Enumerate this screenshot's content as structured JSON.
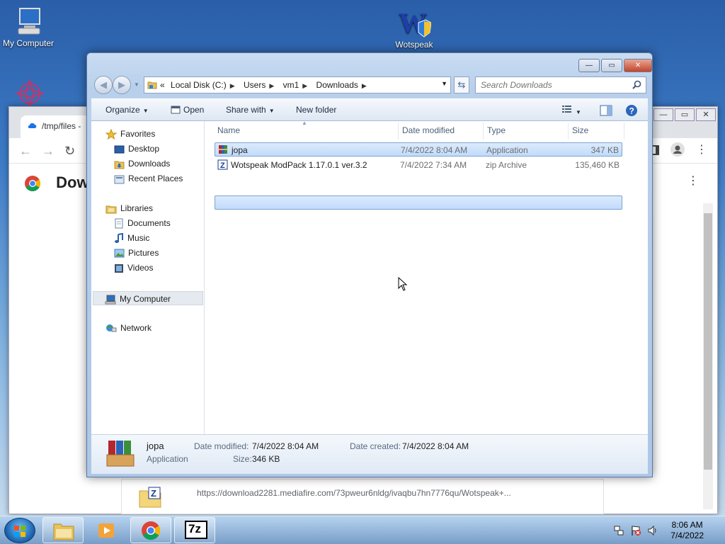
{
  "desktop": {
    "icons": [
      {
        "label": "My Computer",
        "icon": "computer-icon"
      },
      {
        "label": "Wotspeak",
        "icon": "wotspeak-icon"
      },
      {
        "label": "",
        "icon": "ornament-icon"
      }
    ]
  },
  "chrome": {
    "tab_title": "/tmp/files - ",
    "page_heading": "Dow",
    "download_url": "https://download2281.mediafire.com/73pweur6nldg/ivaqbu7hn7776qu/Wotspeak+..."
  },
  "explorer": {
    "title_controls": {
      "minimize": "—",
      "maximize": "▭",
      "close": "✕"
    },
    "breadcrumb": [
      "Local Disk (C:)",
      "Users",
      "vm1",
      "Downloads"
    ],
    "breadcrumb_prefix": "«",
    "search_placeholder": "Search Downloads",
    "toolbar": {
      "organize": "Organize",
      "open": "Open",
      "share_with": "Share with",
      "new_folder": "New folder"
    },
    "nav": {
      "favorites": "Favorites",
      "desktop": "Desktop",
      "downloads": "Downloads",
      "recent_places": "Recent Places",
      "libraries": "Libraries",
      "documents": "Documents",
      "music": "Music",
      "pictures": "Pictures",
      "videos": "Videos",
      "my_computer": "My Computer",
      "network": "Network"
    },
    "columns": {
      "name": "Name",
      "date_modified": "Date modified",
      "type": "Type",
      "size": "Size"
    },
    "files": [
      {
        "name": "jopa",
        "date": "7/4/2022 8:04 AM",
        "type": "Application",
        "size": "347 KB",
        "icon": "winrar-icon"
      },
      {
        "name": "Wotspeak ModPack 1.17.0.1 ver.3.2",
        "date": "7/4/2022 7:34 AM",
        "type": "zip Archive",
        "size": "135,460 KB",
        "icon": "zip-archive-icon"
      }
    ],
    "details": {
      "name": "jopa",
      "type": "Application",
      "date_modified_label": "Date modified:",
      "date_modified": "7/4/2022 8:04 AM",
      "date_created_label": "Date created:",
      "date_created": "7/4/2022 8:04 AM",
      "size_label": "Size:",
      "size": "346 KB"
    }
  },
  "taskbar": {
    "time": "8:06 AM",
    "date": "7/4/2022",
    "apps": [
      "explorer-icon",
      "media-player-icon",
      "chrome-icon",
      "7zip-icon"
    ],
    "seven_zip_label": "7z"
  }
}
